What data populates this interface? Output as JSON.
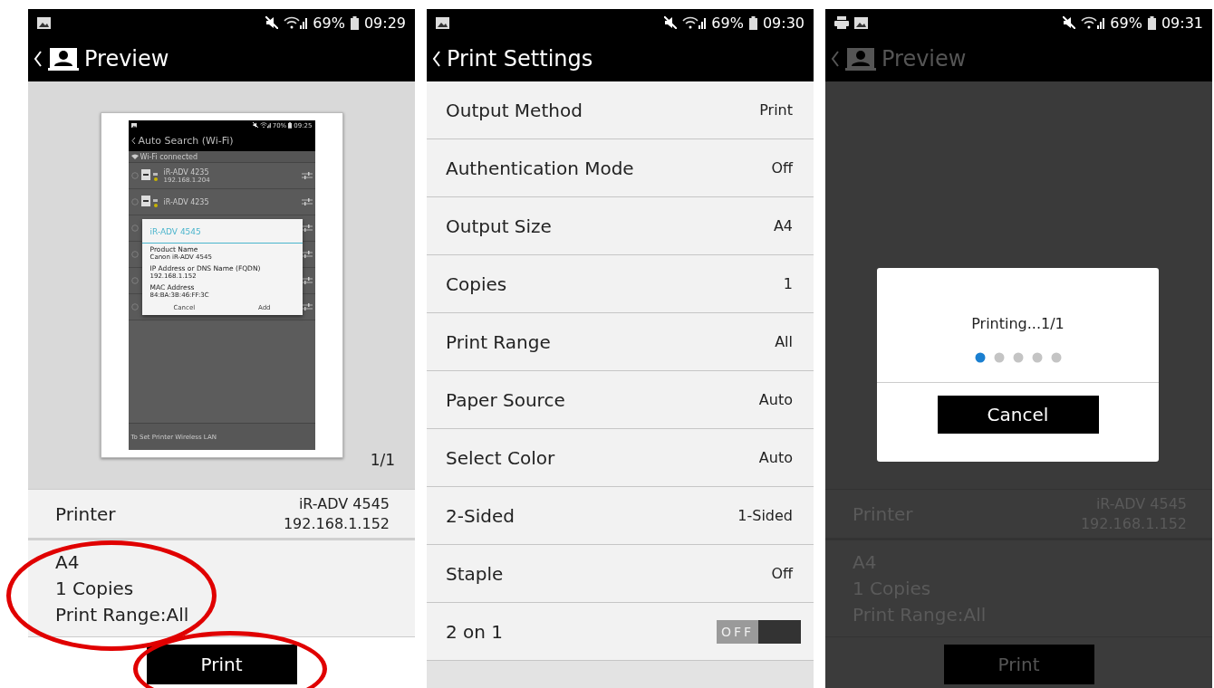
{
  "screens": [
    {
      "kind": "preview",
      "dimmed": false,
      "highlighted": true,
      "status_bar": {
        "print_notification": false,
        "battery": "69%",
        "time": "09:29"
      },
      "title": "Preview",
      "document": {
        "status_bar": {
          "battery": "70%",
          "time": "09:25"
        },
        "title": "Auto Search (Wi-Fi)",
        "wifi": "Wi-Fi connected",
        "printers": [
          {
            "kind": "printer",
            "name": "iR-ADV 4235",
            "address": "192.168.1.204"
          },
          {
            "kind": "printer",
            "name": "iR-ADV 4235"
          },
          {
            "kind": "blank"
          },
          {
            "kind": "blank"
          },
          {
            "kind": "blank"
          },
          {
            "kind": "blank"
          }
        ],
        "dialog": {
          "title": "iR-ADV 4545",
          "fields": [
            {
              "label": "Product Name",
              "value": "Canon iR-ADV 4545"
            },
            {
              "label": "IP Address or DNS Name (FQDN)",
              "value": "192.168.1.152"
            },
            {
              "label": "MAC Address",
              "value": "84:BA:3B:46:FF:3C"
            }
          ],
          "buttons": [
            "Cancel",
            "Add"
          ]
        },
        "footer": "To Set Printer Wireless LAN"
      },
      "page_count": "1/1",
      "printer": {
        "label": "Printer",
        "name": "iR-ADV 4545",
        "address": "192.168.1.152"
      },
      "summary": [
        "A4",
        "1 Copies",
        "Print Range:All"
      ],
      "print_button": "Print"
    },
    {
      "kind": "settings",
      "status_bar": {
        "print_notification": false,
        "battery": "69%",
        "time": "09:30"
      },
      "title": "Print Settings",
      "settings": [
        {
          "kind": "value",
          "label": "Output Method",
          "value": "Print"
        },
        {
          "kind": "value",
          "label": "Authentication Mode",
          "value": "Off"
        },
        {
          "kind": "value",
          "label": "Output Size",
          "value": "A4"
        },
        {
          "kind": "value",
          "label": "Copies",
          "value": "1"
        },
        {
          "kind": "value",
          "label": "Print Range",
          "value": "All"
        },
        {
          "kind": "value",
          "label": "Paper Source",
          "value": "Auto"
        },
        {
          "kind": "value",
          "label": "Select Color",
          "value": "Auto"
        },
        {
          "kind": "value",
          "label": "2-Sided",
          "value": "1-Sided"
        },
        {
          "kind": "value",
          "label": "Staple",
          "value": "Off"
        },
        {
          "kind": "toggle",
          "label": "2 on 1",
          "on": false,
          "value": "OFF"
        }
      ]
    },
    {
      "kind": "preview",
      "dimmed": true,
      "highlighted": false,
      "status_bar": {
        "print_notification": true,
        "battery": "69%",
        "time": "09:31"
      },
      "title": "Preview",
      "printer": {
        "label": "Printer",
        "name": "iR-ADV 4545",
        "address": "192.168.1.152"
      },
      "summary": [
        "A4",
        "1 Copies",
        "Print Range:All"
      ],
      "print_button": "Print",
      "dialog": {
        "message": "Printing...1/1",
        "button": "Cancel"
      }
    }
  ]
}
